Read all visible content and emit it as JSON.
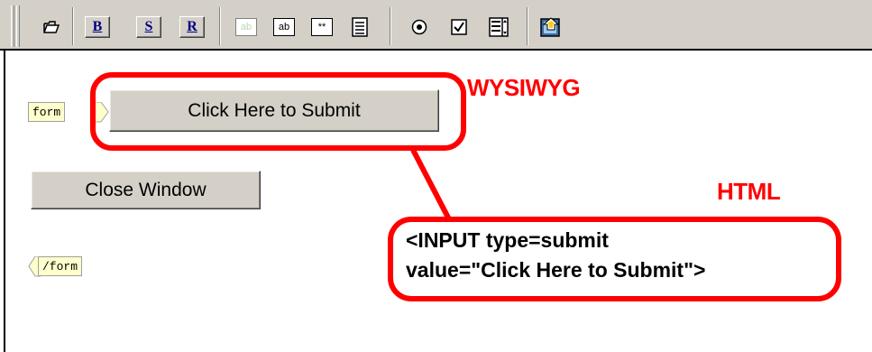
{
  "toolbar": {
    "format_buttons": [
      "B",
      "S",
      "R"
    ],
    "field_icons": [
      "ab",
      "ab",
      "**"
    ],
    "icons": [
      "open-icon",
      "bold-icon",
      "strikethrough-icon",
      "reset-icon",
      "disabled-textbox-icon",
      "textbox-icon",
      "password-field-icon",
      "textarea-icon",
      "radio-button-icon",
      "checkbox-icon",
      "list-box-icon",
      "image-button-icon"
    ]
  },
  "canvas": {
    "form_open_tag": "form",
    "form_close_tag": "/form",
    "submit_button_label": "Click Here to Submit",
    "close_button_label": "Close Window"
  },
  "annotations": {
    "wysiwyg_label": "WYSIWYG",
    "html_label": "HTML",
    "code_line_1": "<INPUT type=submit",
    "code_line_2": "value=\"Click Here to Submit\">",
    "highlight_color": "#ff0000"
  }
}
